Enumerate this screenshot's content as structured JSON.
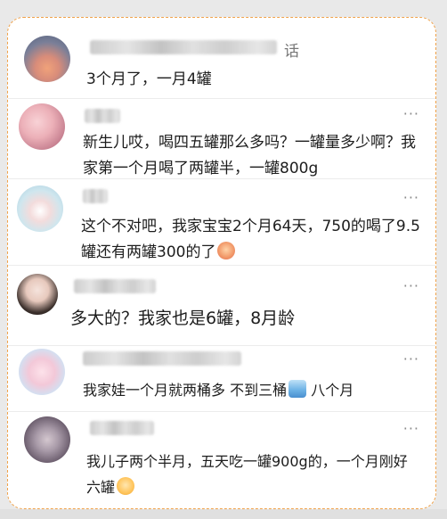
{
  "comments": [
    {
      "name_hint": "话",
      "text": "3个月了，一月4罐"
    },
    {
      "text": "新生儿哎，喝四五罐那么多吗？一罐量多少啊？我家第一个月喝了两罐半，一罐800g"
    },
    {
      "text": "这个不对吧，我家宝宝2个月64天，750的喝了9.5罐还有两罐300的了"
    },
    {
      "text": "多大的？我家也是6罐，8月龄"
    },
    {
      "text": "我家娃一个月就两桶多 不到三桶",
      "text_after": "八个月"
    },
    {
      "text": "我儿子两个半月，五天吃一罐900g的，一个月刚好六罐"
    }
  ],
  "more_label": "···",
  "icons": [
    "more-icon",
    "emoji-icon"
  ],
  "colors": {
    "border_accent": "#f0a24a",
    "text": "#1d1d1d",
    "muted": "#8a8a8a"
  }
}
